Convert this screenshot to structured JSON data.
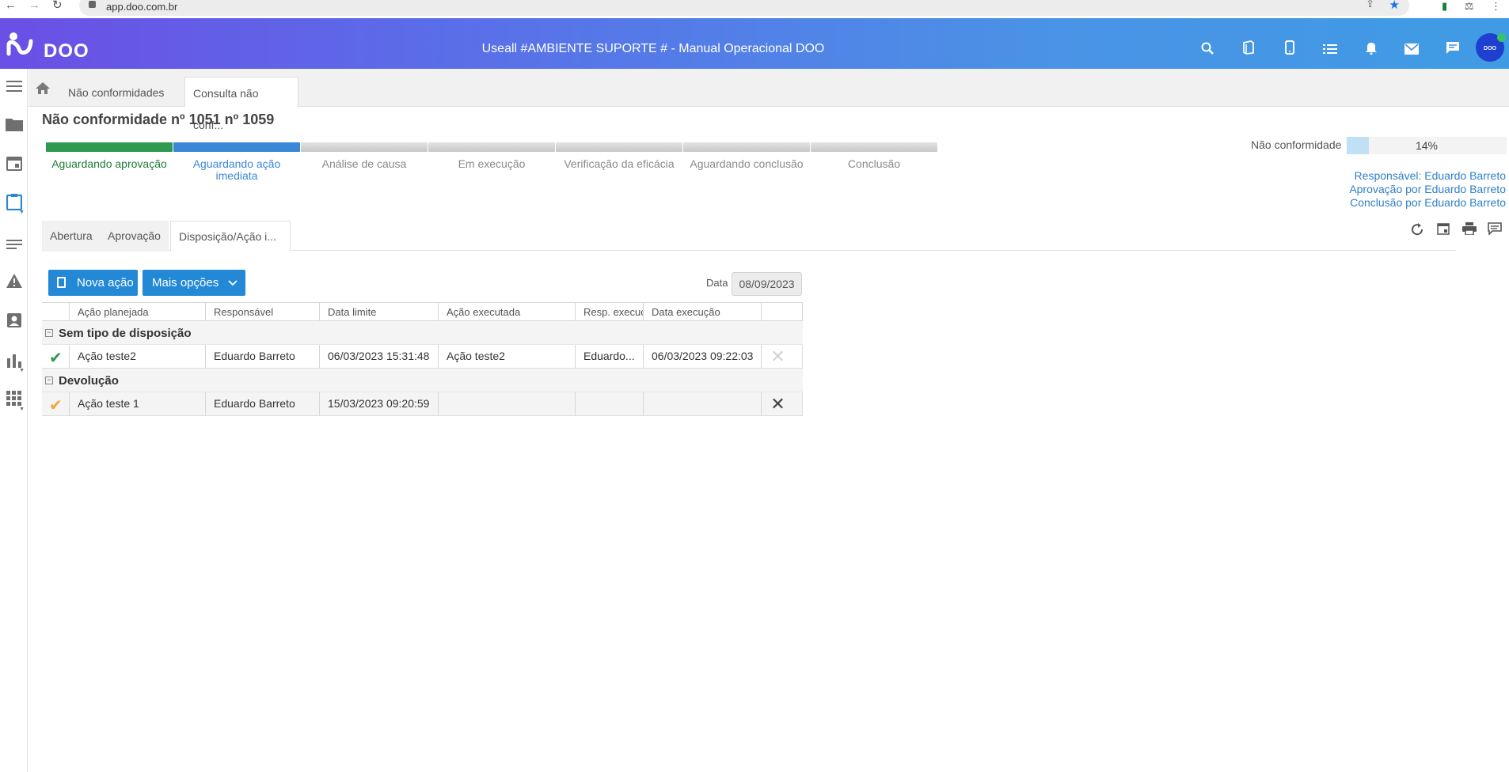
{
  "browser": {
    "url": "app.doo.com.br",
    "back": "←",
    "forward": "→",
    "reload": "↻"
  },
  "app": {
    "logo_text": "DOO",
    "title": "Useall #AMBIENTE SUPORTE # - Manual Operacional DOO",
    "avatar_text": "DOO",
    "header_icons": [
      "search-icon",
      "book-icon",
      "mobile-icon",
      "list-icon",
      "bell-icon",
      "mail-icon",
      "chat-icon"
    ]
  },
  "rail": {
    "items": [
      "menu-icon",
      "folder-icon",
      "calendar-icon",
      "clipboard-icon",
      "text-lines-icon",
      "warning-icon",
      "contact-icon",
      "bar-chart-icon",
      "grid-icon"
    ]
  },
  "breadcrumb": {
    "tabs": [
      "Não conformidades",
      "Consulta não conf..."
    ]
  },
  "page": {
    "title": "Não conformidade nº 1051 nº 1059",
    "steps": [
      {
        "label": "Aguardando aprovação",
        "state": "done"
      },
      {
        "label": "Aguardando ação imediata",
        "state": "current"
      },
      {
        "label": "Análise de causa",
        "state": "todo"
      },
      {
        "label": "Em execução",
        "state": "todo"
      },
      {
        "label": "Verificação da eficácia",
        "state": "todo"
      },
      {
        "label": "Aguardando conclusão",
        "state": "todo"
      },
      {
        "label": "Conclusão",
        "state": "todo"
      }
    ],
    "progress": {
      "label": "Não conformidade",
      "value": 0.14,
      "text": "14%"
    },
    "meta": {
      "responsavel": "Responsável: Eduardo Barreto",
      "aprovacao": "Aprovação por Eduardo Barreto",
      "conclusao": "Conclusão por Eduardo Barreto"
    }
  },
  "inner_tabs": [
    "Abertura",
    "Aprovação",
    "Disposição/Ação i..."
  ],
  "toolbar": {
    "new_action": "Nova ação",
    "more_options": "Mais opções",
    "date_label": "Data",
    "date_value": "08/09/2023"
  },
  "grid": {
    "columns": [
      "Ação planejada",
      "Responsável",
      "Data limite",
      "Ação executada",
      "Resp. execução",
      "Data execução"
    ],
    "groups": [
      {
        "name": "Sem tipo de disposição",
        "rows": [
          {
            "status": "done",
            "cells": [
              "Ação teste2",
              "Eduardo Barreto",
              "06/03/2023 15:31:48",
              "Ação teste2",
              "Eduardo...",
              "06/03/2023 09:22:03"
            ]
          }
        ]
      },
      {
        "name": "Devolução",
        "rows": [
          {
            "status": "pending",
            "cells": [
              "Ação teste 1",
              "Eduardo Barreto",
              "15/03/2023 09:20:59",
              "",
              "",
              ""
            ]
          }
        ]
      }
    ]
  },
  "colors": {
    "header_gradient_start": "#6b4fe6",
    "header_gradient_end": "#3f9be4",
    "accent": "#2389d7",
    "done": "#2f9a4f",
    "pending": "#f0a63a"
  }
}
